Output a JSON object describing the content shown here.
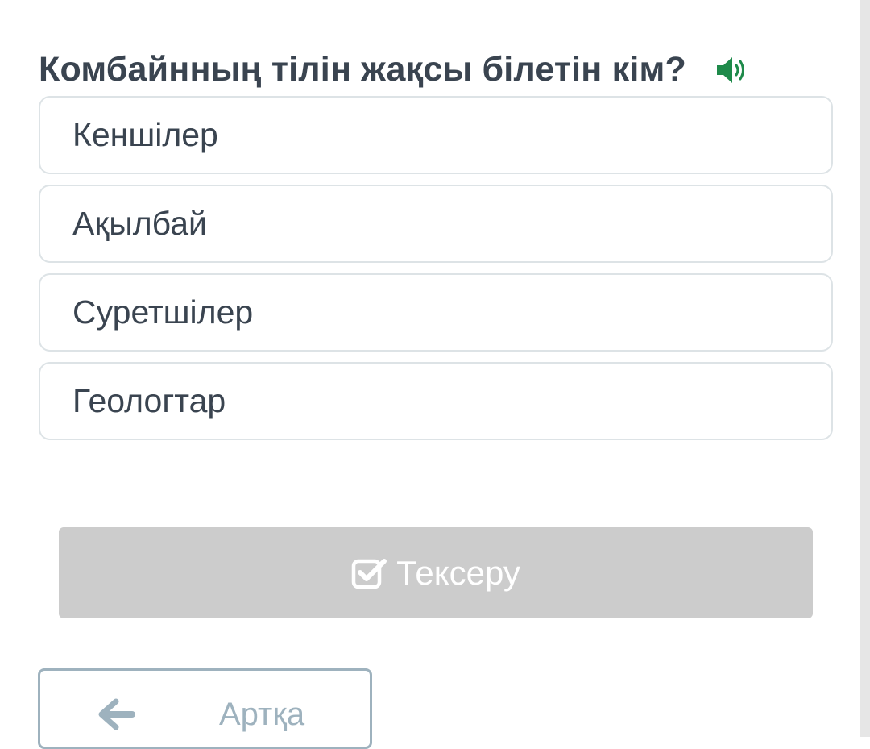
{
  "question": {
    "text": "Комбайнның тілін жақсы білетін кім?",
    "audio_icon": "speaker-icon"
  },
  "options": [
    {
      "label": "Кеншілер"
    },
    {
      "label": "Ақылбай"
    },
    {
      "label": "Суретшілер"
    },
    {
      "label": "Геологтар"
    }
  ],
  "check_button": {
    "label": "Тексеру",
    "icon": "checkbox-check-icon"
  },
  "back_button": {
    "label": "Артқа",
    "icon": "arrow-left-icon"
  },
  "colors": {
    "text": "#3a4450",
    "accent_green": "#1e8a4a",
    "option_border": "#dde3e6",
    "disabled_button": "#cccccc",
    "back_button_border": "#9eb2be"
  }
}
